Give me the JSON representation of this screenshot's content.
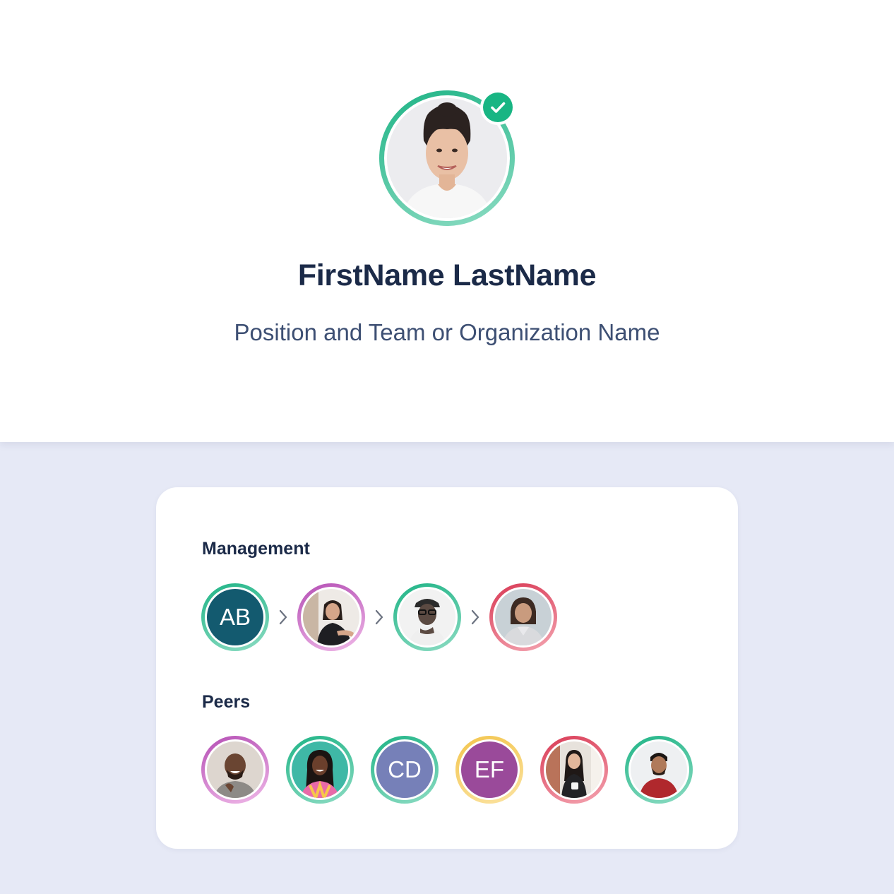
{
  "profile": {
    "name": "FirstName LastName",
    "position": "Position and Team or Organization Name",
    "verified": true
  },
  "management": {
    "title": "Management",
    "people": [
      {
        "initials": "AB",
        "ring": "#1fb486",
        "fill": "#135a6f",
        "type": "initials"
      },
      {
        "ring": "#b54fb5",
        "type": "photo",
        "icon": "woman-seated-photo"
      },
      {
        "ring": "#1fb486",
        "type": "photo",
        "icon": "man-cap-glasses-photo"
      },
      {
        "ring": "#d93a55",
        "type": "photo",
        "icon": "woman-blazer-photo"
      }
    ]
  },
  "peers": {
    "title": "Peers",
    "people": [
      {
        "ring": "#b54fb5",
        "type": "photo",
        "icon": "man-laughing-photo"
      },
      {
        "ring": "#1fb486",
        "type": "photo",
        "icon": "woman-braids-photo"
      },
      {
        "initials": "CD",
        "ring": "#1fb486",
        "fill": "#7680b8",
        "type": "initials"
      },
      {
        "initials": "EF",
        "ring": "#f3c54d",
        "fill": "#9a4a9a",
        "type": "initials"
      },
      {
        "ring": "#d93a55",
        "type": "photo",
        "icon": "woman-mug-photo"
      },
      {
        "ring": "#1fb486",
        "type": "photo",
        "icon": "man-red-shirt-photo"
      }
    ]
  }
}
